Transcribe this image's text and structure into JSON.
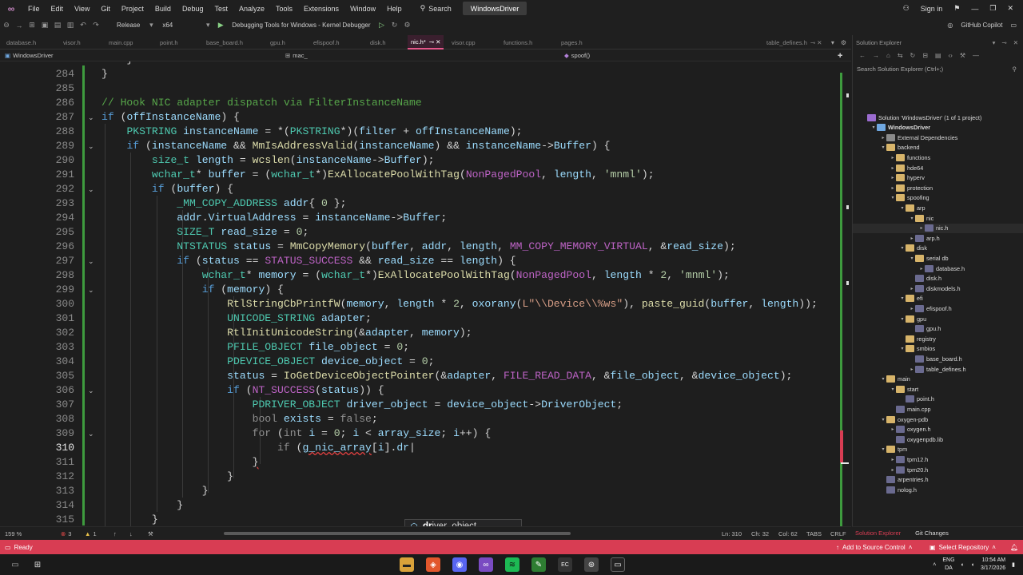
{
  "menubar": {
    "items": [
      "File",
      "Edit",
      "View",
      "Git",
      "Project",
      "Build",
      "Debug",
      "Test",
      "Analyze",
      "Tools",
      "Extensions",
      "Window",
      "Help"
    ],
    "search_label": "Search",
    "solution_name": "WindowsDriver",
    "signin": "Sign in"
  },
  "toolbar": {
    "configuration": "Release",
    "platform": "x64",
    "debug_target": "Debugging Tools for Windows - Kernel Debugger",
    "copilot": "GitHub Copilot"
  },
  "tabs": [
    {
      "label": "database.h",
      "active": false
    },
    {
      "label": "visor.h",
      "active": false
    },
    {
      "label": "main.cpp",
      "active": false
    },
    {
      "label": "point.h",
      "active": false
    },
    {
      "label": "base_board.h",
      "active": false
    },
    {
      "label": "gpu.h",
      "active": false
    },
    {
      "label": "efispoof.h",
      "active": false
    },
    {
      "label": "disk.h",
      "active": false
    },
    {
      "label": "nic.h*",
      "active": true
    },
    {
      "label": "visor.cpp",
      "active": false
    },
    {
      "label": "functions.h",
      "active": false
    },
    {
      "label": "pages.h",
      "active": false
    },
    {
      "label": "table_defines.h",
      "active": false
    }
  ],
  "navbar": {
    "project": "WindowsDriver",
    "scope": "mac_",
    "member": "spoof()"
  },
  "editor": {
    "current_line": 310
  },
  "intellisense": {
    "match": "dr",
    "rest": "iver_object"
  },
  "editor_status": {
    "zoom": "159 %",
    "errors": "3",
    "warnings": "1",
    "line": "Ln: 310",
    "char": "Ch: 32",
    "col": "Col: 62",
    "tabs": "TABS",
    "eol": "CRLF"
  },
  "solution_explorer": {
    "title": "Solution Explorer",
    "search_placeholder": "Search Solution Explorer (Ctrl+;)",
    "tree": [
      {
        "label": "Solution 'WindowsDriver' (1 of 1 project)",
        "kind": "sln",
        "depth": 0,
        "arrow": ""
      },
      {
        "label": "WindowsDriver",
        "kind": "proj",
        "depth": 1,
        "arrow": "▾",
        "bold": true
      },
      {
        "label": "External Dependencies",
        "kind": "ref",
        "depth": 2,
        "arrow": "▸"
      },
      {
        "label": "backend",
        "kind": "folder",
        "depth": 2,
        "arrow": "▾"
      },
      {
        "label": "functions",
        "kind": "folder",
        "depth": 3,
        "arrow": "▸"
      },
      {
        "label": "hde64",
        "kind": "folder",
        "depth": 3,
        "arrow": "▸"
      },
      {
        "label": "hyperv",
        "kind": "folder",
        "depth": 3,
        "arrow": "▸"
      },
      {
        "label": "protection",
        "kind": "folder",
        "depth": 3,
        "arrow": "▸"
      },
      {
        "label": "spoofing",
        "kind": "folder",
        "depth": 3,
        "arrow": "▾"
      },
      {
        "label": "arp",
        "kind": "folder",
        "depth": 4,
        "arrow": "▾"
      },
      {
        "label": "nic",
        "kind": "folder",
        "depth": 5,
        "arrow": "▾"
      },
      {
        "label": "nic.h",
        "kind": "file",
        "depth": 6,
        "arrow": "▸",
        "selected": true
      },
      {
        "label": "arp.h",
        "kind": "file",
        "depth": 5,
        "arrow": "▸"
      },
      {
        "label": "disk",
        "kind": "folder",
        "depth": 4,
        "arrow": "▾"
      },
      {
        "label": "serial db",
        "kind": "folder",
        "depth": 5,
        "arrow": "▾"
      },
      {
        "label": "database.h",
        "kind": "file",
        "depth": 6,
        "arrow": "▸"
      },
      {
        "label": "disk.h",
        "kind": "file",
        "depth": 5,
        "arrow": ""
      },
      {
        "label": "diskmodels.h",
        "kind": "file",
        "depth": 5,
        "arrow": "▸"
      },
      {
        "label": "efi",
        "kind": "folder",
        "depth": 4,
        "arrow": "▾"
      },
      {
        "label": "efispoof.h",
        "kind": "file",
        "depth": 5,
        "arrow": "▸"
      },
      {
        "label": "gpu",
        "kind": "folder",
        "depth": 4,
        "arrow": "▾"
      },
      {
        "label": "gpu.h",
        "kind": "file",
        "depth": 5,
        "arrow": ""
      },
      {
        "label": "registry",
        "kind": "folder",
        "depth": 4,
        "arrow": ""
      },
      {
        "label": "smbios",
        "kind": "folder",
        "depth": 4,
        "arrow": "▾"
      },
      {
        "label": "base_board.h",
        "kind": "file",
        "depth": 5,
        "arrow": ""
      },
      {
        "label": "table_defines.h",
        "kind": "file",
        "depth": 5,
        "arrow": "▸"
      },
      {
        "label": "main",
        "kind": "folder",
        "depth": 2,
        "arrow": "▾"
      },
      {
        "label": "start",
        "kind": "folder",
        "depth": 3,
        "arrow": "▾"
      },
      {
        "label": "point.h",
        "kind": "file",
        "depth": 4,
        "arrow": ""
      },
      {
        "label": "main.cpp",
        "kind": "file",
        "depth": 3,
        "arrow": ""
      },
      {
        "label": "oxygen-pdb",
        "kind": "folder",
        "depth": 2,
        "arrow": "▾"
      },
      {
        "label": "oxygen.h",
        "kind": "file",
        "depth": 3,
        "arrow": "▸"
      },
      {
        "label": "oxygenpdb.lib",
        "kind": "file",
        "depth": 3,
        "arrow": ""
      },
      {
        "label": "tpm",
        "kind": "folder",
        "depth": 2,
        "arrow": "▾"
      },
      {
        "label": "tpm12.h",
        "kind": "file",
        "depth": 3,
        "arrow": "▸"
      },
      {
        "label": "tpm20.h",
        "kind": "file",
        "depth": 3,
        "arrow": "▸"
      },
      {
        "label": "arpentries.h",
        "kind": "file",
        "depth": 2,
        "arrow": ""
      },
      {
        "label": "nolog.h",
        "kind": "file",
        "depth": 2,
        "arrow": ""
      }
    ],
    "bottom_tabs": [
      "Solution Explorer",
      "Git Changes"
    ]
  },
  "statusbar": {
    "state": "Ready",
    "source_control": "Add to Source Control",
    "repo": "Select Repository"
  },
  "taskbar": {
    "lang1": "ENG",
    "lang2": "DA",
    "time": "10:54 AM",
    "date": "3/17/2026"
  },
  "colors": {
    "accent": "#d83d53",
    "editor_bg": "#1e1e1e",
    "keyword": "#569cd6",
    "type": "#4ec9b0",
    "function": "#dcdcaa",
    "comment": "#57a64a"
  }
}
